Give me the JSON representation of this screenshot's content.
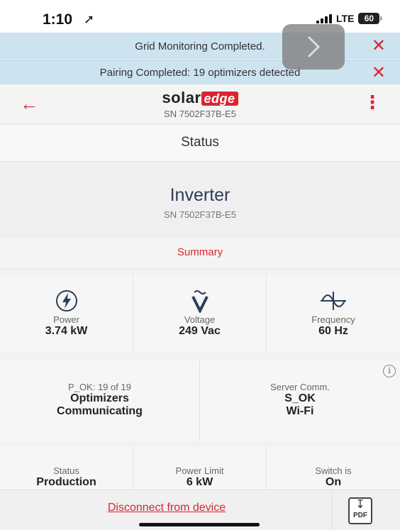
{
  "status_bar": {
    "time": "1:10",
    "network": "LTE",
    "battery": "60"
  },
  "notifications": [
    {
      "text": "Grid Monitoring Completed."
    },
    {
      "text": "Pairing Completed: 19 optimizers detected"
    }
  ],
  "header": {
    "logo_text": "solar",
    "logo_badge": "edge",
    "serial": "SN 7502F37B-E5"
  },
  "status_title": "Status",
  "device": {
    "name": "Inverter",
    "serial": "SN 7502F37B-E5"
  },
  "summary_label": "Summary",
  "metrics": [
    {
      "label": "Power",
      "value": "3.74 kW",
      "icon": "lightning-icon"
    },
    {
      "label": "Voltage",
      "value": "249 Vac",
      "icon": "voltage-icon"
    },
    {
      "label": "Frequency",
      "value": "60 Hz",
      "icon": "sine-wave-icon"
    }
  ],
  "optimizers": {
    "label": "P_OK: 19 of 19",
    "line1": "Optimizers",
    "line2": "Communicating"
  },
  "server": {
    "label": "Server Comm.",
    "line1": "S_OK",
    "line2": "Wi-Fi"
  },
  "bottom_stats": [
    {
      "label": "Status",
      "value": "Production"
    },
    {
      "label": "Power Limit",
      "value": "6 kW"
    },
    {
      "label": "Switch is",
      "value": "On"
    }
  ],
  "footer": {
    "disconnect_label": "Disconnect from device",
    "pdf_label": "PDF"
  },
  "colors": {
    "accent": "#d9262e",
    "banner": "#cde3f0",
    "title": "#2a3e5a"
  }
}
